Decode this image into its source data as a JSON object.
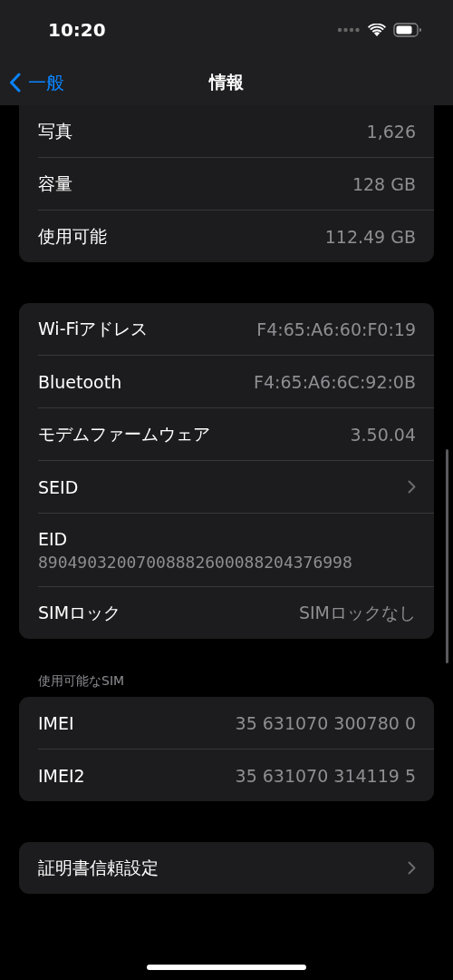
{
  "status_bar": {
    "time": "10:20"
  },
  "nav": {
    "back": "一般",
    "title": "情報"
  },
  "groups": [
    {
      "rows": [
        {
          "kind": "value",
          "label": "写真",
          "value": "1,626"
        },
        {
          "kind": "value",
          "label": "容量",
          "value": "128 GB"
        },
        {
          "kind": "value",
          "label": "使用可能",
          "value": "112.49 GB"
        }
      ]
    },
    {
      "rows": [
        {
          "kind": "value",
          "label": "Wi-Fiアドレス",
          "value": "F4:65:A6:60:F0:19"
        },
        {
          "kind": "value",
          "label": "Bluetooth",
          "value": "F4:65:A6:6C:92:0B"
        },
        {
          "kind": "value",
          "label": "モデムファームウェア",
          "value": "3.50.04"
        },
        {
          "kind": "chevron",
          "label": "SEID"
        },
        {
          "kind": "stacked",
          "label": "EID",
          "value": "89049032007008882600088204376998"
        },
        {
          "kind": "value",
          "label": "SIMロック",
          "value": "SIMロックなし"
        }
      ]
    },
    {
      "header": "使用可能なSIM",
      "rows": [
        {
          "kind": "value",
          "label": "IMEI",
          "value": "35 631070 300780 0"
        },
        {
          "kind": "value",
          "label": "IMEI2",
          "value": "35 631070 314119 5"
        }
      ]
    },
    {
      "rows": [
        {
          "kind": "chevron",
          "label": "証明書信頼設定"
        }
      ]
    }
  ]
}
